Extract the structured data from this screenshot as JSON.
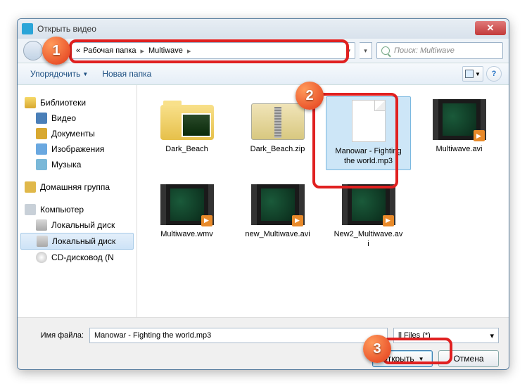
{
  "window": {
    "title": "Открыть видео"
  },
  "nav": {
    "crumb_prefix": "«",
    "crumb1": "Рабочая папка",
    "crumb2": "Multiwave",
    "search_placeholder": "Поиск: Multiwave"
  },
  "toolbar": {
    "organize": "Упорядочить",
    "newfolder": "Новая папка"
  },
  "sidebar": {
    "libraries": "Библиотеки",
    "video": "Видео",
    "documents": "Документы",
    "images": "Изображения",
    "music": "Музыка",
    "homegroup": "Домашняя группа",
    "computer": "Компьютер",
    "disk1": "Локальный диск",
    "disk2": "Локальный диск",
    "cd": "CD-дисковод (N"
  },
  "files": [
    {
      "name": "Dark_Beach",
      "type": "folder-pic"
    },
    {
      "name": "Dark_Beach.zip",
      "type": "zip"
    },
    {
      "name": "Manowar - Fighting the world.mp3",
      "type": "blank",
      "sel": true
    },
    {
      "name": "Multiwave.avi",
      "type": "video"
    },
    {
      "name": "Multiwave.wmv",
      "type": "video"
    },
    {
      "name": "new_Multiwave.avi",
      "type": "video"
    },
    {
      "name": "New2_Multiwave.avi",
      "type": "video"
    }
  ],
  "footer": {
    "filename_label": "Имя файла:",
    "filename_value": "Manowar - Fighting the world.mp3",
    "filter": "ll Files (*)",
    "open": "Открыть",
    "cancel": "Отмена"
  },
  "badges": {
    "b1": "1",
    "b2": "2",
    "b3": "3"
  }
}
